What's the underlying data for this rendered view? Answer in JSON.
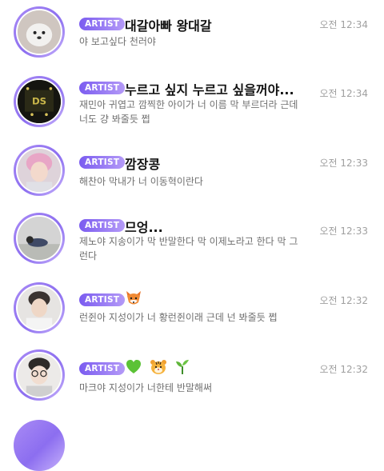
{
  "rows": [
    {
      "badge": "ARTIST",
      "name": "대갈아빠 왕대갈",
      "time": "오전 12:34",
      "message": "야 보고싶다 천러야",
      "emoji": ""
    },
    {
      "badge": "ARTIST",
      "name": "누르고 싶지 누르고 싶을꺼야...",
      "time": "오전 12:34",
      "message": "재민아 귀엽고 깜찍한 아이가 너 이름 막 부르더라 근데 너도 걍 봐줄듯 쩝",
      "emoji": ""
    },
    {
      "badge": "ARTIST",
      "name": "깜장콩",
      "time": "오전 12:33",
      "message": "해찬아 막내가 너 이동혁이란다",
      "emoji": ""
    },
    {
      "badge": "ARTIST",
      "name": "므엉...",
      "time": "오전 12:33",
      "message": "제노야 지송이가 막 반말한다 막 이제노라고 한다 막 그런다",
      "emoji": ""
    },
    {
      "badge": "ARTIST",
      "name": "",
      "time": "오전 12:32",
      "message": "런쥔아 지성이가 너 황런쥔이래 근데 넌 봐줄듯 쩝",
      "emoji": "fox-icon"
    },
    {
      "badge": "ARTIST",
      "name": "",
      "time": "오전 12:32",
      "message": "마크야 지성이가 너한테 반말해써",
      "emoji": "heart-tiger-sprout-icons"
    }
  ],
  "colors": {
    "accent": "#8c6ef0",
    "time": "#a0a0a0",
    "message": "#6f6f6f"
  }
}
